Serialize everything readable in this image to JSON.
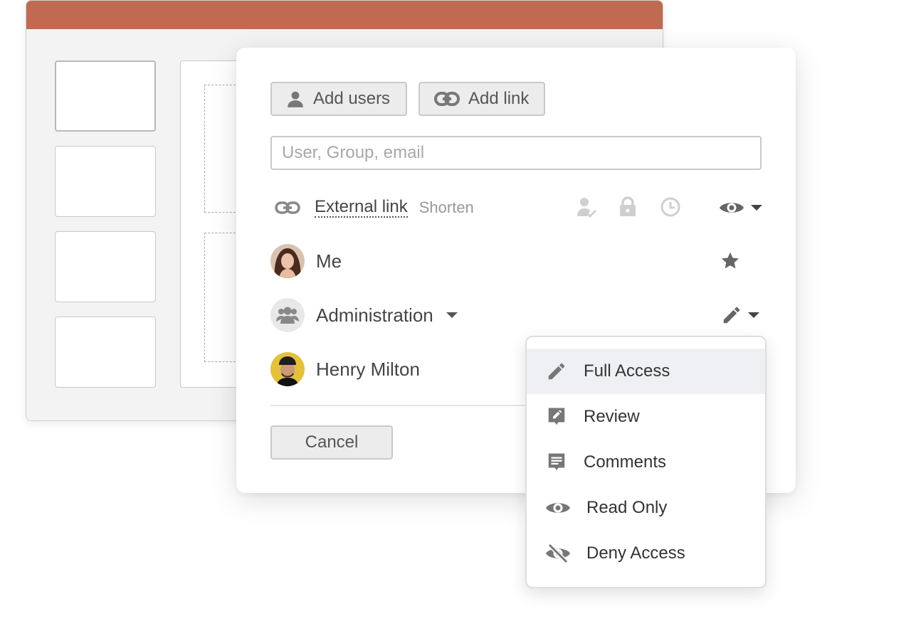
{
  "toolbar": {
    "add_users_label": "Add users",
    "add_link_label": "Add link"
  },
  "search": {
    "placeholder": "User, Group, email"
  },
  "external_link": {
    "label": "External link",
    "shorten_label": "Shorten"
  },
  "users": [
    {
      "name": "Me",
      "role_icon": "star-icon"
    },
    {
      "name": "Administration",
      "role_icon": "pencil-icon"
    },
    {
      "name": "Henry Milton"
    }
  ],
  "footer": {
    "cancel_label": "Cancel"
  },
  "access_menu": {
    "selected": "Full Access",
    "items": [
      {
        "label": "Full Access",
        "icon": "pencil-icon"
      },
      {
        "label": "Review",
        "icon": "review-icon"
      },
      {
        "label": "Comments",
        "icon": "comment-icon"
      },
      {
        "label": "Read Only",
        "icon": "eye-icon"
      },
      {
        "label": "Deny Access",
        "icon": "eye-slash-icon"
      }
    ]
  },
  "colors": {
    "titlebar": "#c06a52",
    "menu_highlight": "#eff0f4",
    "icon_gray": "#888888",
    "icon_light": "#cfcfcf"
  }
}
